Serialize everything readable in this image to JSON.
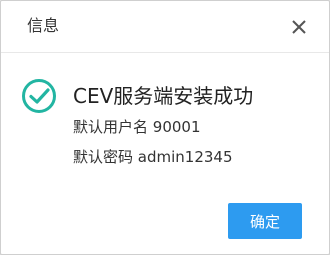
{
  "dialog": {
    "title": "信息",
    "message": "CEV服务端安装成功",
    "default_user_label": "默认用户名",
    "default_user_value": "90001",
    "default_password_label": "默认密码",
    "default_password_value": "admin12345",
    "ok_label": "确定"
  },
  "icons": {
    "close": "close-icon",
    "success": "check-circle-icon"
  },
  "colors": {
    "accent": "#2d9bf0",
    "success": "#22b5a2"
  }
}
